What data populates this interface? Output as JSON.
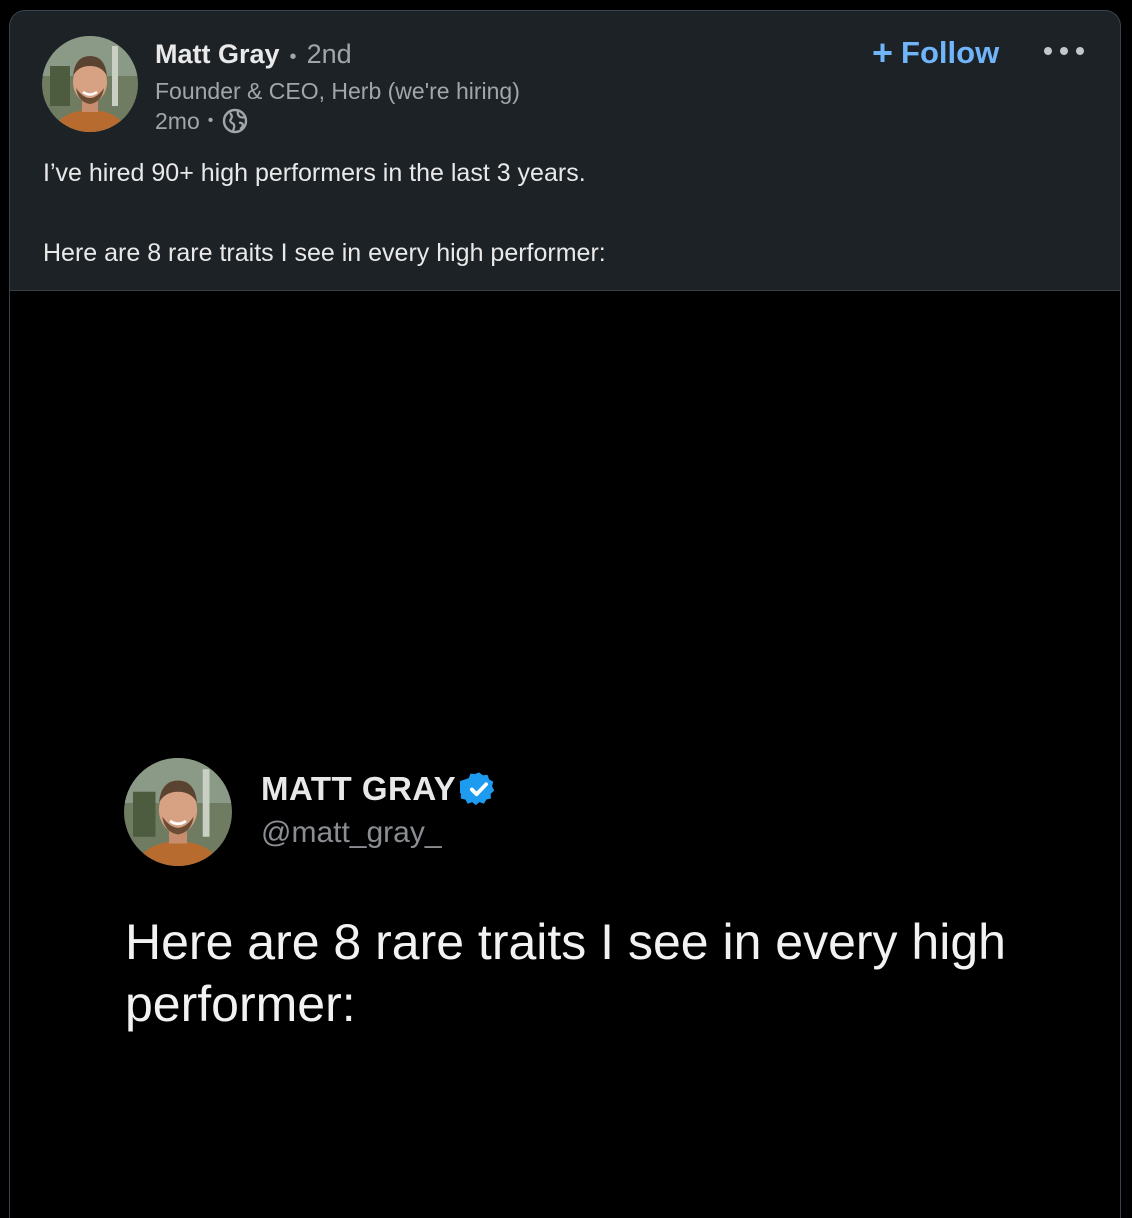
{
  "post": {
    "author": {
      "name": "Matt Gray",
      "separator": "•",
      "degree": "2nd",
      "headline": "Founder & CEO, Herb (we're hiring)",
      "time": "2mo",
      "time_separator": "•",
      "visibility_icon": "globe-icon"
    },
    "actions": {
      "follow_icon": "+",
      "follow_label": "Follow",
      "more_icon": "more-horizontal-icon"
    },
    "text": {
      "line1": "I’ve hired 90+ high performers in the last 3 years.",
      "line2": "Here are 8 rare traits I see in every high performer:"
    }
  },
  "media": {
    "tweet": {
      "name": "MATT GRAY",
      "verified_icon": "verified-badge-icon",
      "handle": "@matt_gray_",
      "text": "Here are 8 rare traits I see in every high performer:"
    }
  },
  "colors": {
    "card_background": "#1d2226",
    "media_background": "#000000",
    "follow_blue": "#70b5f9",
    "verified_blue": "#1d9bf0",
    "secondary_text": "#a2a6a9"
  }
}
